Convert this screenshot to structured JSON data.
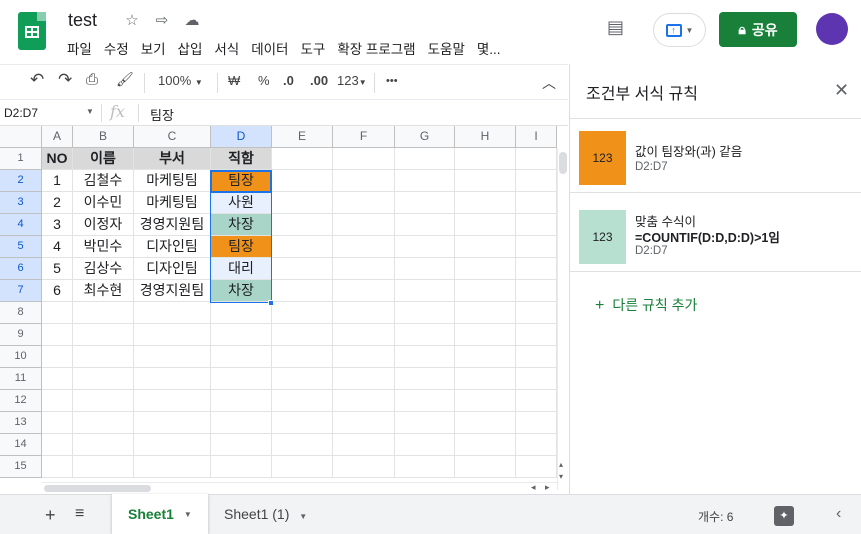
{
  "header": {
    "title": "test",
    "menu": [
      "파일",
      "수정",
      "보기",
      "삽입",
      "서식",
      "데이터",
      "도구",
      "확장 프로그램",
      "도움말",
      "몇..."
    ],
    "share_label": "공유"
  },
  "toolbar": {
    "zoom": "100%",
    "currency": "₩",
    "percent": "%",
    "dec_decrease": ".0",
    "dec_increase": ".00",
    "format": "123",
    "more": "•••"
  },
  "formula_bar": {
    "name_box": "D2:D7",
    "fx": "fx",
    "value": "팀장"
  },
  "columns": [
    "A",
    "B",
    "C",
    "D",
    "E",
    "F",
    "G",
    "H",
    "I"
  ],
  "rows": [
    "1",
    "2",
    "3",
    "4",
    "5",
    "6",
    "7",
    "8",
    "9",
    "10",
    "11",
    "12",
    "13",
    "14",
    "15"
  ],
  "table": {
    "headers": [
      "NO",
      "이름",
      "부서",
      "직함"
    ],
    "data": [
      [
        "1",
        "김철수",
        "마케팅팀",
        "팀장"
      ],
      [
        "2",
        "이수민",
        "마케팅팀",
        "사원"
      ],
      [
        "3",
        "이정자",
        "경영지원팀",
        "차장"
      ],
      [
        "4",
        "박민수",
        "디자인팀",
        "팀장"
      ],
      [
        "5",
        "김상수",
        "디자인팀",
        "대리"
      ],
      [
        "6",
        "최수현",
        "경영지원팀",
        "차장"
      ]
    ],
    "d_colors": [
      "#f0911a",
      "#e8f0fe",
      "#a8d5c7",
      "#f0911a",
      "#e8f0fe",
      "#a8d5c7"
    ]
  },
  "sheets": {
    "active": "Sheet1",
    "other": "Sheet1 (1)"
  },
  "status": {
    "count": "개수: 6"
  },
  "panel": {
    "title": "조건부 서식 규칙",
    "rules": [
      {
        "swatch_text": "123",
        "swatch_color": "#f0911a",
        "line1": "값이 팀장와(과) 같음",
        "line2": "",
        "range": "D2:D7"
      },
      {
        "swatch_text": "123",
        "swatch_color": "#b8e0d0",
        "line1": "맞춤 수식이",
        "line2": "=COUNTIF(D:D,D:D)>1임",
        "range": "D2:D7"
      }
    ],
    "add_rule": "다른 규칙 추가"
  }
}
